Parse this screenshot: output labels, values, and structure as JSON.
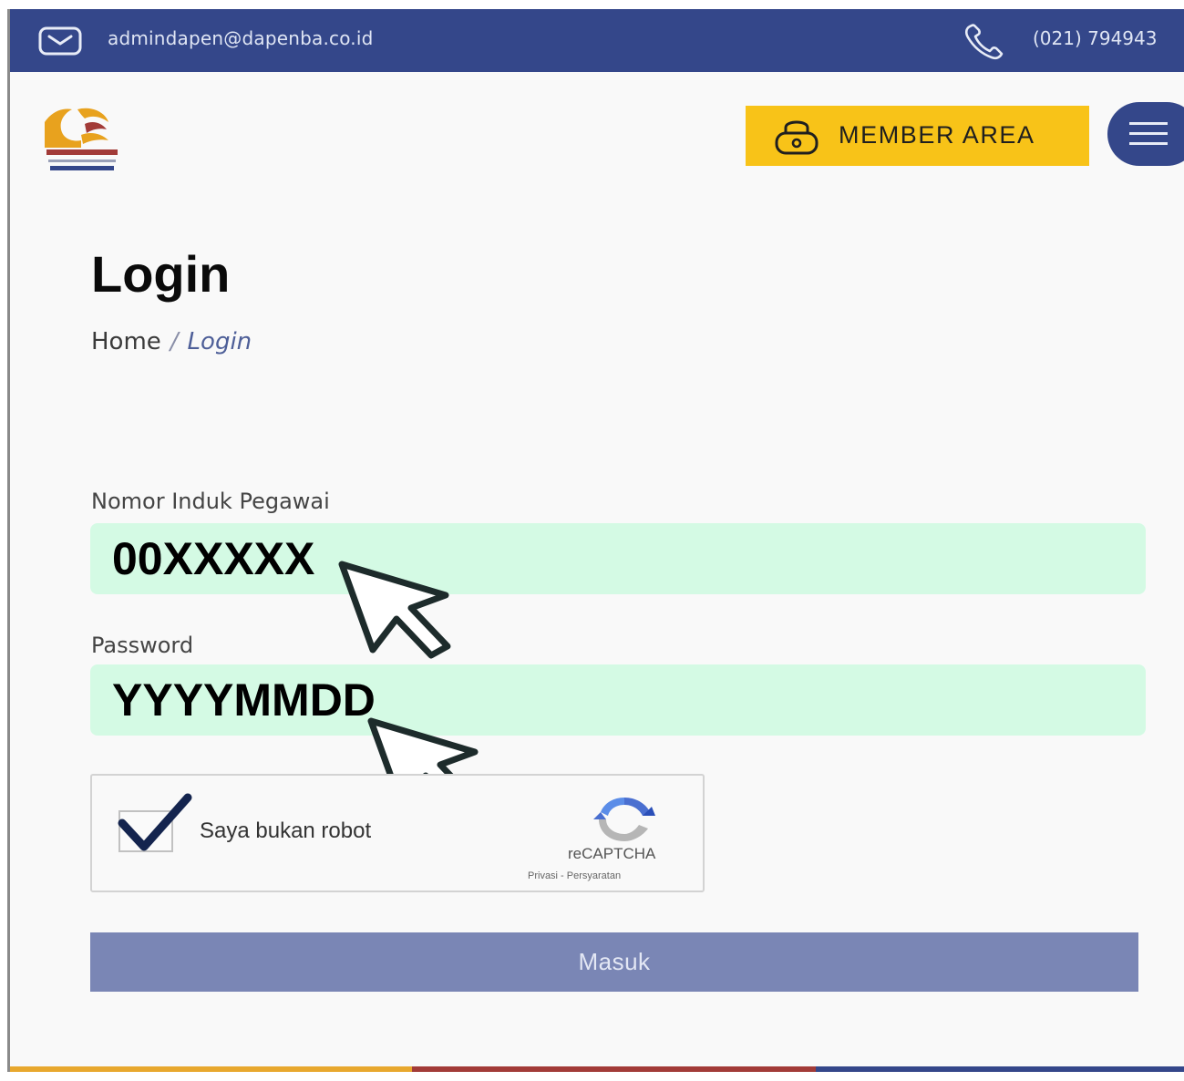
{
  "topbar": {
    "email": "admindapen@dapenba.co.id",
    "phone": "(021) 794943",
    "mail_icon": "mail-icon",
    "phone_icon": "phone-icon",
    "background": "#34478a"
  },
  "header": {
    "logo_icon": "dapenba-logo",
    "member_area_label": "MEMBER AREA",
    "member_area_color": "#f8c318",
    "lock_icon": "lock-icon",
    "menu_icon": "hamburger-icon"
  },
  "page": {
    "title": "Login",
    "breadcrumb": {
      "home": "Home",
      "separator": "/",
      "current": "Login"
    }
  },
  "form": {
    "nip": {
      "label": "Nomor Induk Pegawai",
      "value": "00XXXXX"
    },
    "password": {
      "label": "Password",
      "value": "YYYYMMDD"
    },
    "field_color": "#d4fae4",
    "captcha": {
      "label": "Saya bukan robot",
      "brand": "reCAPTCHA",
      "links": "Privasi - Persyaratan",
      "checked": true
    },
    "submit_label": "Masuk",
    "submit_color": "#7a86b5"
  },
  "footer_stripe_colors": [
    "#e8a82e",
    "#a23b38",
    "#34478a"
  ]
}
